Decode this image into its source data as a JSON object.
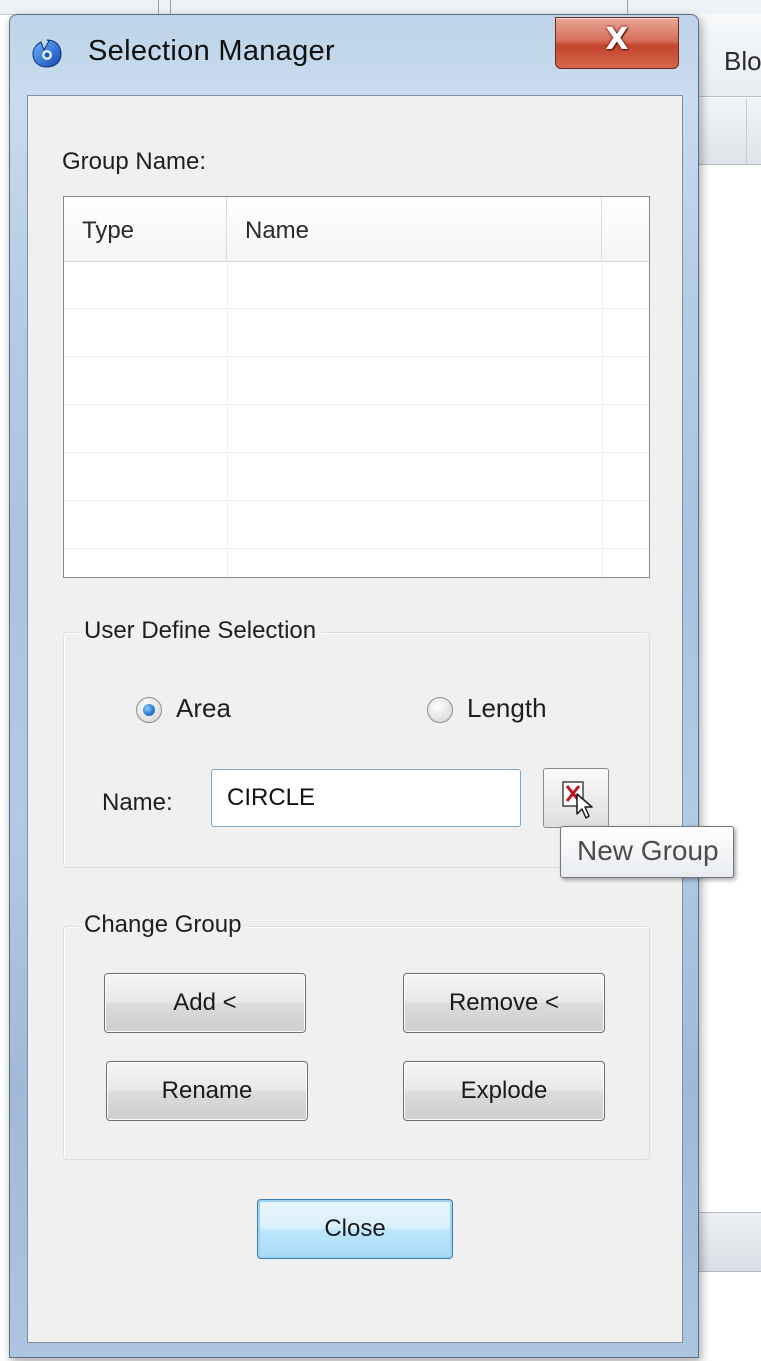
{
  "background": {
    "ribbon_label": "Blo"
  },
  "dialog": {
    "title": "Selection Manager",
    "close_glyph": "X",
    "app_icon": "cad-app-icon"
  },
  "groups": {
    "label": "Group Name:",
    "columns": [
      "Type",
      "Name",
      ""
    ],
    "rows": []
  },
  "user_define": {
    "title": "User Define Selection",
    "options": [
      {
        "label": "Area",
        "selected": true
      },
      {
        "label": "Length",
        "selected": false
      }
    ],
    "name_label": "Name:",
    "name_value": "CIRCLE",
    "pick_icon": "select-objects-icon",
    "tooltip": "New Group"
  },
  "change_group": {
    "title": "Change Group",
    "add_label": "Add <",
    "remove_label": "Remove <",
    "rename_label": "Rename",
    "explode_label": "Explode"
  },
  "close_label": "Close",
  "colors": {
    "accent": "#2a7bd1",
    "title_close": "#c4452c",
    "default_button": "#bee6fd"
  }
}
